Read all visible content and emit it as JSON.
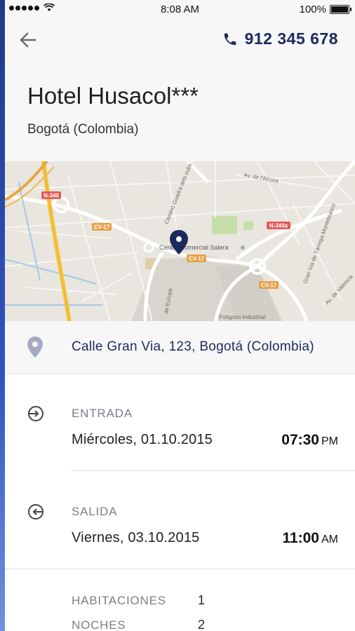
{
  "status_bar": {
    "time": "8:08 AM",
    "battery": "100%"
  },
  "header": {
    "phone": "912 345 678",
    "hotel_name": "Hotel Husacol***",
    "city": "Bogotá (Colombia)"
  },
  "map": {
    "labels": {
      "road_n340": "N-340",
      "road_cv17_a": "CV-17",
      "road_cv17_b": "CV-17",
      "road_cv17_c": "CV-17",
      "road_n340a": "N-340a",
      "avenue": "Av. de l'Alcora",
      "camino": "Camino Guadra dels cubs",
      "mall": "Centro Comercial Salera",
      "poligono": "Polígono Industrial",
      "gran_via": "Gran Via de Tárrega Monteblanco",
      "europa": "de Europa",
      "av_valencia": "Av. de Valencia"
    },
    "colors": {
      "background": "#e9e6df",
      "highway": "#f5c542",
      "water": "#a7c7ea",
      "park": "#c6dfa9",
      "pin": "#1c2a5e"
    }
  },
  "address": {
    "text": "Calle Gran Via, 123, Bogotá (Colombia)",
    "icon": "location-pin-icon"
  },
  "checkin": {
    "label": "ENTRADA",
    "date": "Miércoles, 01.10.2015",
    "time": "07:30",
    "ampm": "PM",
    "icon": "entrance-arrow-icon"
  },
  "checkout": {
    "label": "SALIDA",
    "date": "Viernes, 03.10.2015",
    "time": "11:00",
    "ampm": "AM",
    "icon": "exit-arrow-icon"
  },
  "summary": {
    "rooms_label": "HABITACIONES",
    "rooms_value": "1",
    "nights_label": "NOCHES",
    "nights_value": "2"
  },
  "colors": {
    "accent": "#1c2a5e",
    "muted": "#7a7f87",
    "header_bg": "#f7f7f7"
  }
}
